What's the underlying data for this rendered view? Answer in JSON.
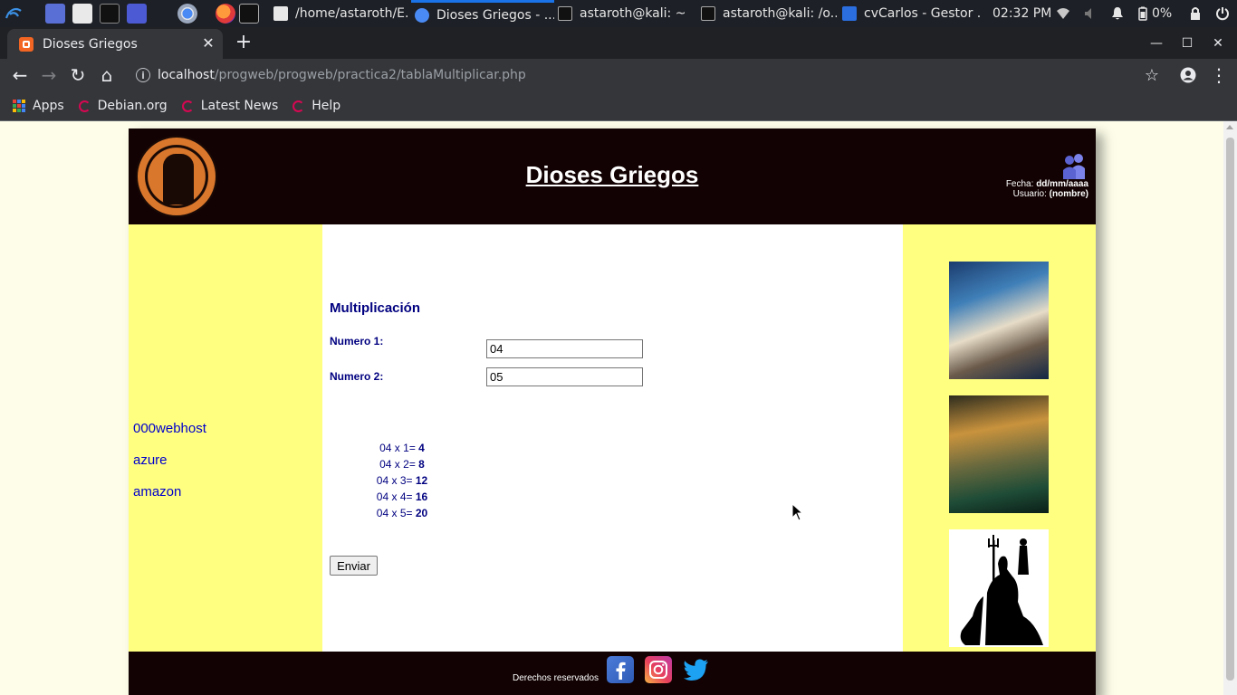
{
  "taskbar": {
    "tasks": [
      {
        "label": "/home/astaroth/E..."
      },
      {
        "label": "Dioses Griegos - ..."
      },
      {
        "label": "astaroth@kali: ~"
      },
      {
        "label": "astaroth@kali: /o..."
      },
      {
        "label": "cvCarlos - Gestor ..."
      }
    ],
    "clock": "02:32 PM",
    "battery": "0%"
  },
  "browser": {
    "tab_title": "Dioses Griegos",
    "url_host": "localhost",
    "url_path": "/progweb/progweb/practica2/tablaMultiplicar.php",
    "bookmarks": [
      {
        "label": "Apps",
        "icon": "apps-grid-icon"
      },
      {
        "label": "Debian.org",
        "icon": "debian-icon"
      },
      {
        "label": "Latest News",
        "icon": "debian-icon"
      },
      {
        "label": "Help",
        "icon": "debian-icon"
      }
    ]
  },
  "site": {
    "title": "Dioses Griegos",
    "fecha_label": "Fecha:",
    "fecha_value": "dd/mm/aaaa",
    "usuario_label": "Usuario:",
    "usuario_value": "(nombre)",
    "side_links": [
      "000webhost",
      "azure",
      "amazon"
    ],
    "footer_text": "Derechos reservados",
    "social": [
      "facebook-icon",
      "instagram-icon",
      "twitter-icon"
    ]
  },
  "form": {
    "title": "Multiplicación",
    "label1": "Numero 1:",
    "value1": "04",
    "label2": "Numero 2:",
    "value2": "05",
    "rows": [
      {
        "expr": "04 x 1=",
        "result": "4"
      },
      {
        "expr": "04 x 2=",
        "result": "8"
      },
      {
        "expr": "04 x 3=",
        "result": "12"
      },
      {
        "expr": "04 x 4=",
        "result": "16"
      },
      {
        "expr": "04 x 5=",
        "result": "20"
      }
    ],
    "submit_label": "Enviar"
  }
}
